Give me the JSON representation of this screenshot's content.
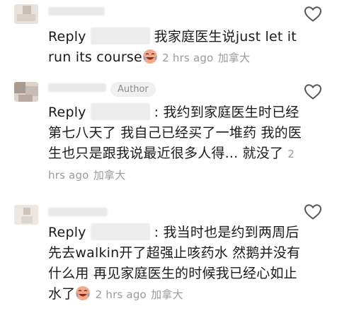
{
  "comments": [
    {
      "reply_label": "Reply",
      "text": "我家庭医生说just let it run its course",
      "time": "2 hrs ago",
      "location": "加拿大",
      "has_emoji": true
    },
    {
      "badge": "Author",
      "reply_label": "Reply",
      "text": ": 我约到家庭医生时已经第七八天了 我自己已经买了一堆药 我的医生也只是跟我说最近很多人得... 就没了",
      "time": "2 hrs ago",
      "location": "加拿大"
    },
    {
      "reply_label": "Reply",
      "text": ": 我当时也是约到两周后 先去walkin开了超强止咳药水 然鹅并没有什么用 再见家庭医生的时候我已经心如止水了",
      "time": "2 hrs ago",
      "location": "加拿大",
      "has_emoji": true
    }
  ],
  "colors": {
    "text": "#1a1a1a",
    "meta": "#9a9a9a",
    "badge_bg": "#f0f0f0"
  },
  "icons": {
    "like": "heart-outline-icon",
    "emoji": "crying-laughing-emoji"
  }
}
